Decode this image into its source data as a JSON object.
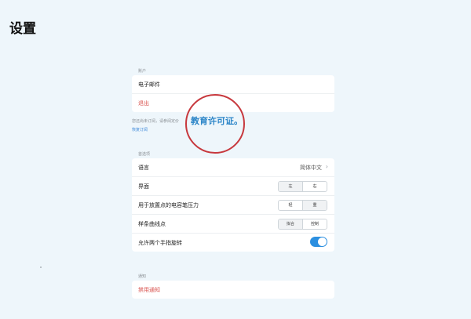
{
  "page": {
    "title": "设置"
  },
  "account": {
    "label": "账户",
    "email": "电子邮件",
    "logout": "退出",
    "note": "您还尚未订阅，请参阅定价",
    "restore": "恢复订阅"
  },
  "preferences": {
    "label": "首选项",
    "language": {
      "label": "语言",
      "value": "简体中文"
    },
    "interface": {
      "label": "界面",
      "options": [
        "左",
        "右"
      ],
      "selected": "左"
    },
    "pressure": {
      "label": "用于放置点的电容笔压力",
      "options": [
        "轻",
        "重"
      ],
      "selected": "重"
    },
    "spline": {
      "label": "样条曲线点",
      "options": [
        "拟合",
        "控制"
      ],
      "selected": "拟合"
    },
    "two_finger": {
      "label": "允许两个手指旋转",
      "enabled": true
    }
  },
  "notifications": {
    "label": "通知",
    "disable": "禁用通知"
  },
  "watermark": {
    "text": "教育许可证。"
  },
  "colors": {
    "accent": "#2b8fe0",
    "danger": "#d9534f",
    "stamp": "#c7383d"
  }
}
